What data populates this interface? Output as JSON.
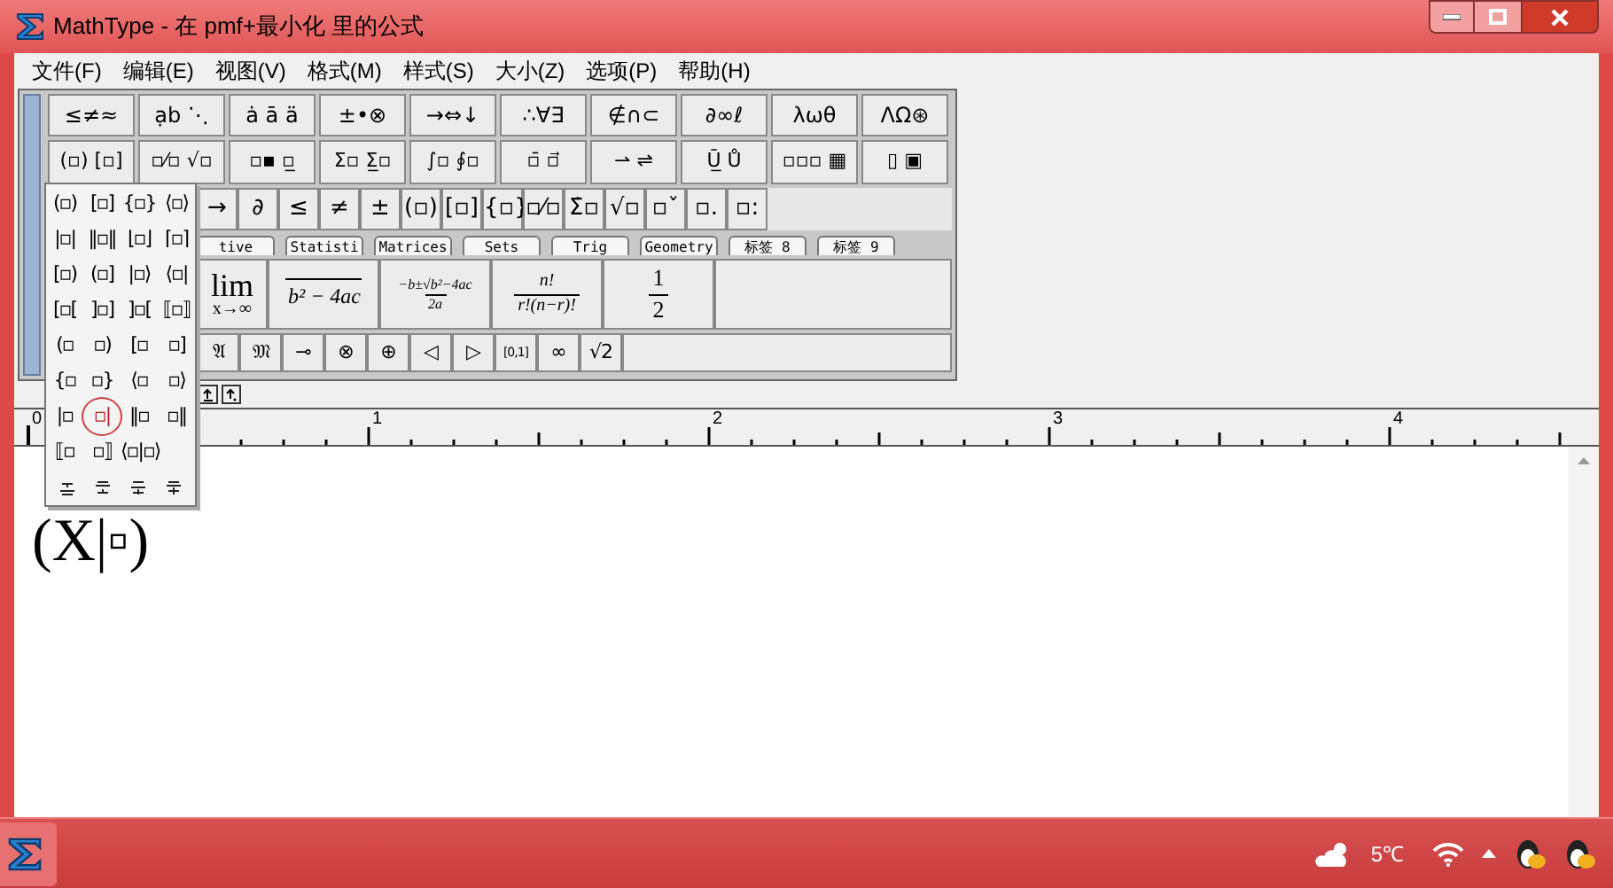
{
  "window": {
    "title": "MathType - 在 pmf+最小化 里的公式"
  },
  "menu": [
    "文件(F)",
    "编辑(E)",
    "视图(V)",
    "格式(M)",
    "样式(S)",
    "大小(Z)",
    "选项(P)",
    "帮助(H)"
  ],
  "toolbar": {
    "symbol_palettes": [
      "≤≠≈",
      "ạb ⋱",
      "ȧ ā ä",
      "±•⊗",
      "→⇔↓",
      "∴∀∃",
      "∉∩⊂",
      "∂∞ℓ",
      "λωθ",
      "ΛΩ⊛"
    ],
    "template_palettes": [
      "(▫) [▫]",
      "▫⁄▫ √▫",
      "▫▪ ▫̲",
      "Σ▫ Σ̲▫",
      "∫▫ ∮▫",
      "▫̄ ▫⃗",
      "⇀ ⇌",
      "Ū̲ Ů",
      "▫▫▫ ▦",
      "▯ ▣"
    ],
    "small_bar": [
      "→",
      "∂",
      "≤",
      "≠",
      "±",
      "(▫)",
      "[▫]",
      "{▫}",
      "▫⁄▫",
      "Σ̇▫",
      "√▫",
      "▫ˇ",
      "▫.",
      "▫:"
    ],
    "tabs": [
      "tive",
      "Statisti",
      "Matrices",
      "Sets",
      "Trig",
      "Geometry",
      "标签 8",
      "标签 9"
    ],
    "large_templates": [
      {
        "kind": "limit",
        "top": "lim",
        "bottom": "x→∞"
      },
      {
        "kind": "radical",
        "text": "b² − 4ac"
      },
      {
        "kind": "fraction",
        "num": "−b±√b²−4ac",
        "den": "2a"
      },
      {
        "kind": "fraction",
        "num": "n!",
        "den": "r!(n−r)!"
      },
      {
        "kind": "fraction",
        "num": "1",
        "den": "2"
      }
    ],
    "small_bar_2": [
      "𝔄",
      "𝔐",
      "⊸",
      "⊗",
      "⊕",
      "◁",
      "▷",
      "[0,1]",
      "∞",
      "√2"
    ]
  },
  "bracket_menu": [
    [
      {
        "label": "(▫)",
        "selected": false
      },
      {
        "label": "[▫]",
        "selected": false
      },
      {
        "label": "{▫}",
        "selected": false
      },
      {
        "label": "⟨▫⟩",
        "selected": false
      }
    ],
    [
      {
        "label": "|▫|",
        "selected": false
      },
      {
        "label": "‖▫‖",
        "selected": false
      },
      {
        "label": "⌊▫⌋",
        "selected": false
      },
      {
        "label": "⌈▫⌉",
        "selected": false
      }
    ],
    [
      {
        "label": "[▫)",
        "selected": false
      },
      {
        "label": "(▫]",
        "selected": false
      },
      {
        "label": "|▫⟩",
        "selected": false
      },
      {
        "label": "⟨▫|",
        "selected": false
      }
    ],
    [
      {
        "label": "[▫[",
        "selected": false
      },
      {
        "label": "]▫]",
        "selected": false
      },
      {
        "label": "]▫[",
        "selected": false
      },
      {
        "label": "⟦▫⟧",
        "selected": false
      }
    ],
    [
      {
        "label": "(▫",
        "selected": false
      },
      {
        "label": "▫)",
        "selected": false
      },
      {
        "label": "[▫",
        "selected": false
      },
      {
        "label": "▫]",
        "selected": false
      }
    ],
    [
      {
        "label": "{▫",
        "selected": false
      },
      {
        "label": "▫}",
        "selected": false
      },
      {
        "label": "⟨▫",
        "selected": false
      },
      {
        "label": "▫⟩",
        "selected": false
      }
    ],
    [
      {
        "label": "|▫",
        "selected": false
      },
      {
        "label": "▫|",
        "selected": true
      },
      {
        "label": "‖▫",
        "selected": false
      },
      {
        "label": "▫‖",
        "selected": false
      }
    ],
    [
      {
        "label": "⟦▫",
        "selected": false
      },
      {
        "label": "▫⟧",
        "selected": false
      },
      {
        "label": "⟨▫|▫⟩",
        "selected": false
      }
    ]
  ],
  "ruler": [
    "0",
    "1",
    "2",
    "3",
    "4"
  ],
  "document": {
    "equation": "(X|▫)"
  },
  "taskbar": {
    "temperature": "5℃"
  }
}
